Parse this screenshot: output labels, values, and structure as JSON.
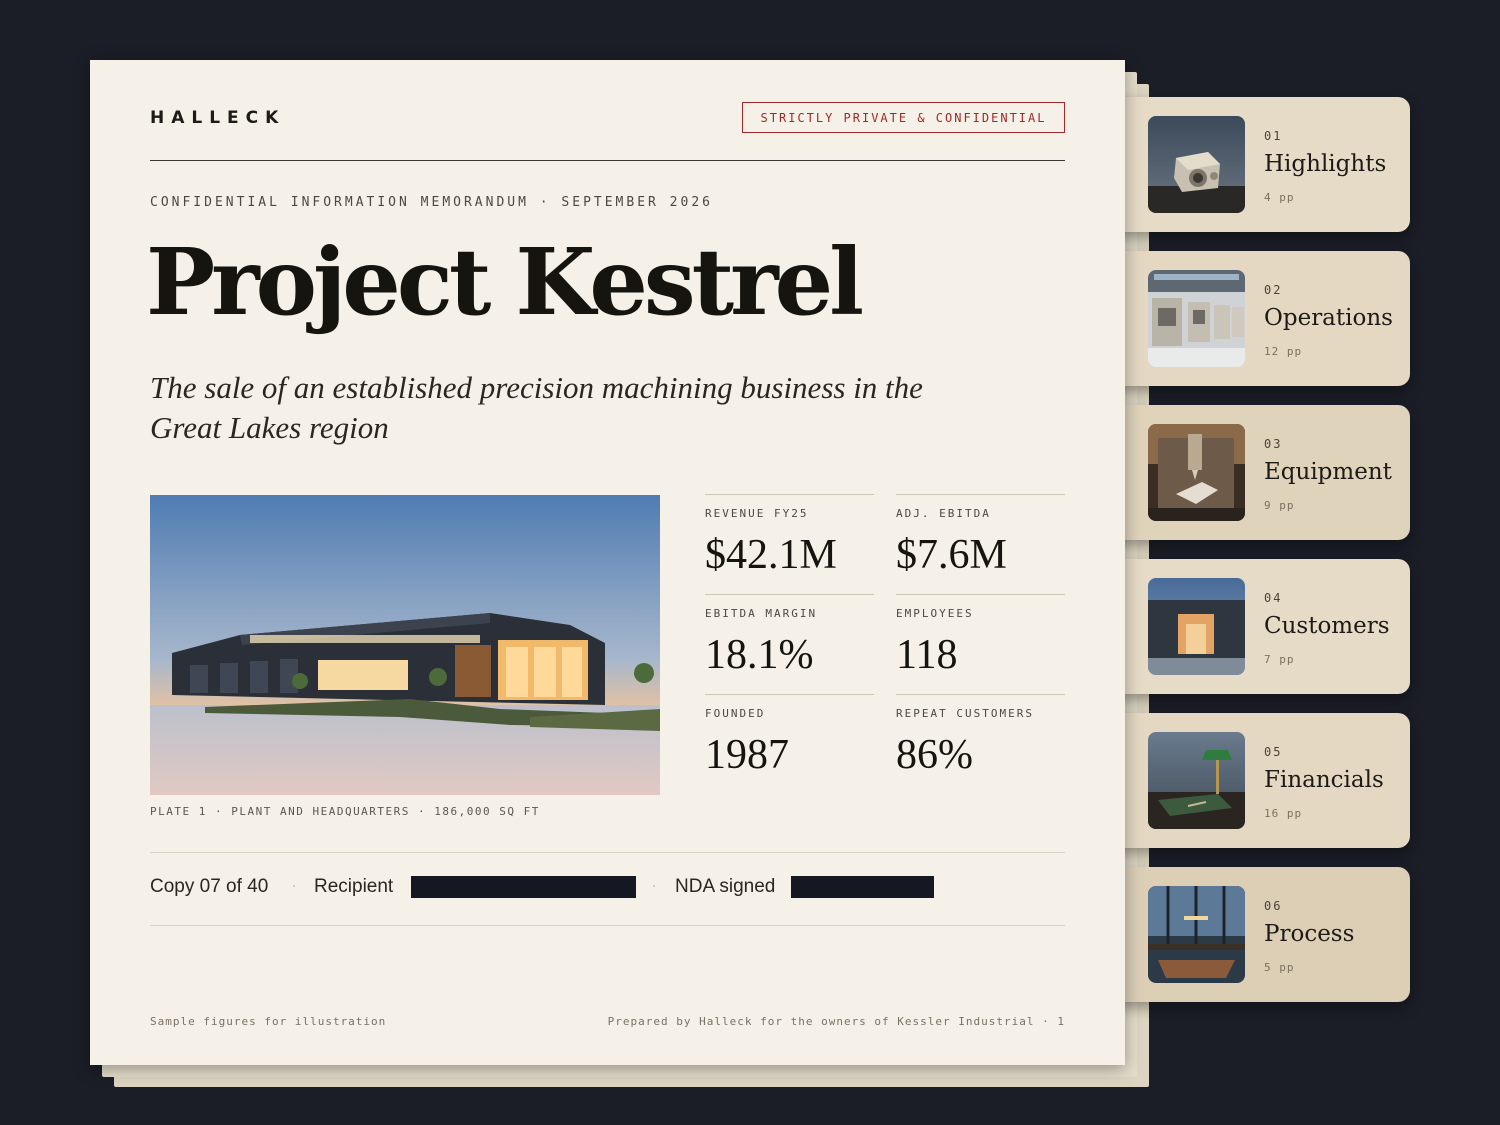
{
  "document": {
    "brand": "HALLECK",
    "stamp": "STRICTLY PRIVATE & CONFIDENTIAL",
    "kicker": "CONFIDENTIAL INFORMATION MEMORANDUM · SEPTEMBER 2026",
    "title": "Project Kestrel",
    "subtitle": "The sale of an established precision machining business in the Great Lakes region",
    "photo_caption": "PLATE 1 · PLANT AND HEADQUARTERS · 186,000 SQ FT",
    "stats": [
      {
        "label": "REVENUE FY25",
        "value": "$42.1M"
      },
      {
        "label": "ADJ. EBITDA",
        "value": "$7.6M"
      },
      {
        "label": "EBITDA MARGIN",
        "value": "18.1%"
      },
      {
        "label": "EMPLOYEES",
        "value": "118"
      },
      {
        "label": "FOUNDED",
        "value": "1987"
      },
      {
        "label": "REPEAT CUSTOMERS",
        "value": "86%"
      }
    ],
    "meta": {
      "copy": "Copy 07 of 40",
      "separator": "·",
      "recipient_label": "Recipient",
      "nda_label": "NDA signed"
    },
    "footer_left": "Sample figures for illustration",
    "footer_right": "Prepared by Halleck for the owners of Kessler Industrial · 1"
  },
  "sections": [
    {
      "num": "01",
      "label": "Highlights",
      "pages": "4 pp"
    },
    {
      "num": "02",
      "label": "Operations",
      "pages": "12 pp"
    },
    {
      "num": "03",
      "label": "Equipment",
      "pages": "9 pp"
    },
    {
      "num": "04",
      "label": "Customers",
      "pages": "7 pp"
    },
    {
      "num": "05",
      "label": "Financials",
      "pages": "16 pp"
    },
    {
      "num": "06",
      "label": "Process",
      "pages": "5 pp"
    }
  ],
  "colors": {
    "background": "#1b1e27",
    "page": "#f5f1e8",
    "stamp": "#9c2a2a",
    "tab": "#e2d6c0",
    "redaction": "#151821"
  }
}
